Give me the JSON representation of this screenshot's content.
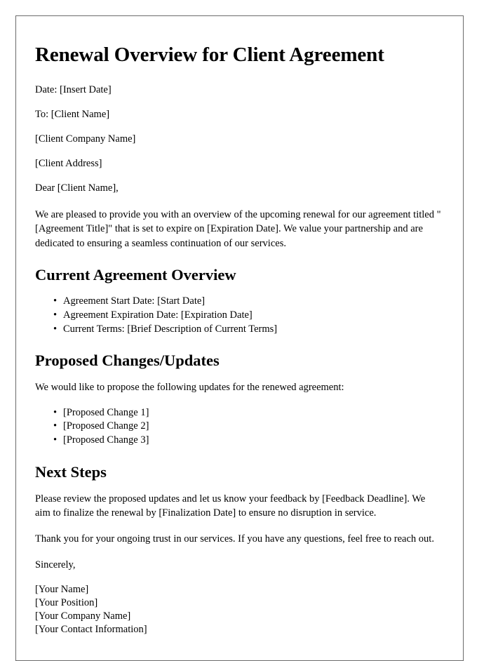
{
  "document": {
    "title": "Renewal Overview for Client Agreement",
    "meta": {
      "date_line": "Date: [Insert Date]",
      "to_line": "To: [Client Name]",
      "client_company": "[Client Company Name]",
      "client_address": "[Client Address]"
    },
    "salutation": "Dear [Client Name],",
    "intro_paragraph": "We are pleased to provide you with an overview of the upcoming renewal for our agreement titled \"[Agreement Title]\" that is set to expire on [Expiration Date]. We value your partnership and are dedicated to ensuring a seamless continuation of our services.",
    "sections": [
      {
        "heading": "Current Agreement Overview",
        "bullets": [
          "Agreement Start Date: [Start Date]",
          "Agreement Expiration Date: [Expiration Date]",
          "Current Terms: [Brief Description of Current Terms]"
        ]
      },
      {
        "heading": "Proposed Changes/Updates",
        "lead_paragraph": "We would like to propose the following updates for the renewed agreement:",
        "bullets": [
          "[Proposed Change 1]",
          "[Proposed Change 2]",
          "[Proposed Change 3]"
        ]
      },
      {
        "heading": "Next Steps",
        "paragraphs": [
          "Please review the proposed updates and let us know your feedback by [Feedback Deadline]. We aim to finalize the renewal by [Finalization Date] to ensure no disruption in service.",
          "Thank you for your ongoing trust in our services. If you have any questions, feel free to reach out."
        ]
      }
    ],
    "closing": "Sincerely,",
    "signature": {
      "name": "[Your Name]",
      "position": "[Your Position]",
      "company": "[Your Company Name]",
      "contact": "[Your Contact Information]"
    }
  },
  "colors": {
    "page_background": "#ffffff",
    "text": "#000000",
    "page_border": "#6b6b6b"
  }
}
